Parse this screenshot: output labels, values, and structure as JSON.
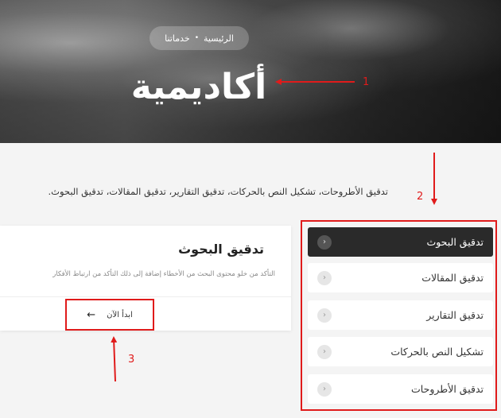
{
  "hero": {
    "breadcrumb_home": "الرئيسية",
    "breadcrumb_separator": "•",
    "breadcrumb_current": "خدماتنا",
    "title": "أكاديمية"
  },
  "intro": {
    "text": "تدقيق الأطروحات، تشكيل النص بالحركات، تدقيق التقارير، تدقيق المقالات، تدقيق البحوث."
  },
  "nav": {
    "items": [
      {
        "label": "تدقيق البحوث",
        "active": true
      },
      {
        "label": "تدقيق المقالات",
        "active": false
      },
      {
        "label": "تدقيق التقارير",
        "active": false
      },
      {
        "label": "تشكيل النص بالحركات",
        "active": false
      },
      {
        "label": "تدقيق الأطروحات",
        "active": false
      }
    ],
    "arrow_icon": "chevron-left-icon"
  },
  "card": {
    "title": "تدقيق البحوث",
    "description": "التأكد من خلو محتوى البحث من الأخطاء إضافة إلى ذلك التأكد من ارتباط الأفكار",
    "button_label": "ابدأ الآن",
    "button_icon": "arrow-left-icon"
  },
  "annotations": {
    "labels": [
      "1",
      "2",
      "3"
    ],
    "color": "#e01b1b"
  }
}
